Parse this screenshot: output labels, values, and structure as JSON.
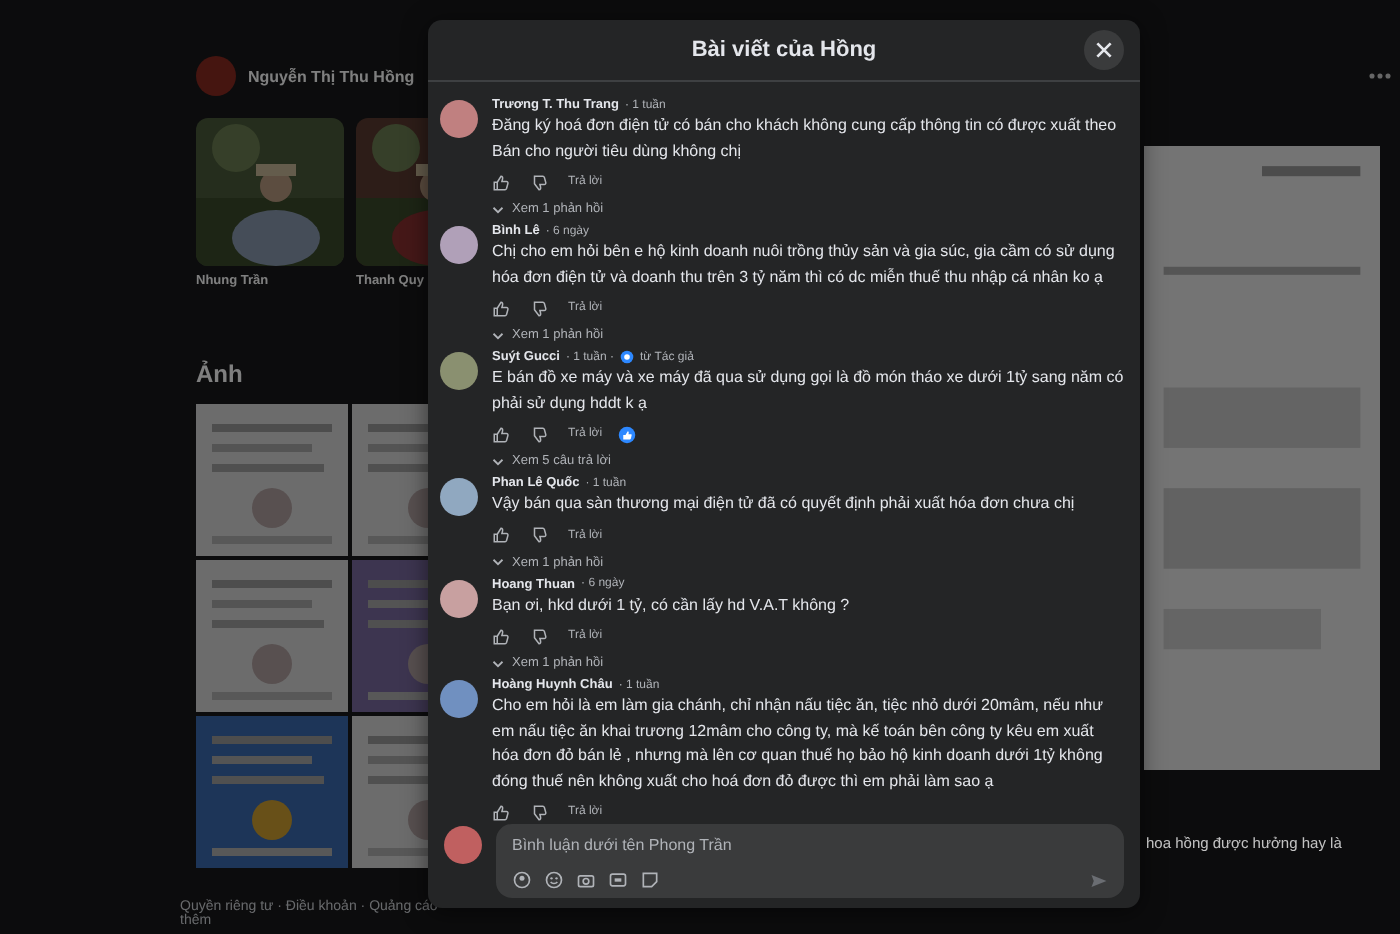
{
  "background": {
    "profile_name": "Nguyễn Thị Thu Hồng",
    "friends": [
      {
        "name": "Nhung Trần"
      },
      {
        "name": "Thanh Quy"
      }
    ],
    "photos_heading": "Ảnh",
    "footer": "Quyền riêng tư · Điều khoản · Quảng cáo",
    "footer_more": "thêm",
    "post_snippet": "hoa hồng được hưởng hay là"
  },
  "dialog": {
    "title": "Bài viết của Hồng",
    "comments": [
      {
        "author": "Trương T. Thu Trang",
        "time": "· 1 tuần",
        "text": "Đăng ký hoá đơn điện tử có bán cho khách không cung cấp thông tin có được xuất theo Bán cho người tiêu dùng không chị",
        "reply": "Trả lời",
        "reaction": false,
        "more_replies": "Xem 1 phản hồi"
      },
      {
        "author": "Bình Lê",
        "time": "· 6 ngày",
        "text": "Chị cho em hỏi bên e hộ kinh doanh nuôi trồng thủy sản và gia súc, gia cầm có sử dụng hóa đơn điện tử và doanh thu trên 3 tỷ năm thì có dc miễn thuế thu nhập cá nhân ko ạ",
        "reply": "Trả lời",
        "reaction": false,
        "more_replies": "Xem 1 phản hồi"
      },
      {
        "author": "Suýt Gucci",
        "time": "· 1 tuần ·",
        "author_badge": "từ Tác giả",
        "text": "E bán đồ xe máy và xe máy đã qua sử dụng gọi là đồ món tháo xe dưới 1tỷ sang năm có phải sử dụng hddt k ạ",
        "reply": "Trả lời",
        "reaction": true,
        "more_replies": "Xem 5 câu trả lời"
      },
      {
        "author": "Phan Lê Quốc",
        "time": "· 1 tuần",
        "text": "Vậy bán qua sàn thương mại điện tử đã có quyết định phải xuất hóa đơn chưa chị",
        "reply": "Trả lời",
        "reaction": false,
        "more_replies": "Xem 1 phản hồi"
      },
      {
        "author": "Hoang Thuan",
        "time": "· 6 ngày",
        "text": "Bạn ơi, hkd dưới 1 tỷ, có cần lấy hd V.A.T không ?",
        "reply": "Trả lời",
        "reaction": false,
        "more_replies": "Xem 1 phản hồi"
      },
      {
        "author": "Hoàng Huynh Châu",
        "time": "· 1 tuần",
        "text": "Cho em hỏi là em làm gia chánh, chỉ nhận nấu tiệc ăn, tiệc nhỏ dưới 20mâm, nếu như em nấu tiệc ăn khai trương 12mâm cho công ty, mà kế toán bên công ty kêu em xuất hóa đơn đỏ bán lẻ , nhưng mà lên cơ quan thuế họ bảo hộ kinh doanh dưới 1tỷ không đóng thuế nên không xuất cho hoá đơn đỏ được thì em phải làm sao ạ",
        "reply": "Trả lời",
        "reaction": false
      }
    ],
    "composer": {
      "placeholder": "Bình luận dưới tên Phong Trần"
    }
  }
}
